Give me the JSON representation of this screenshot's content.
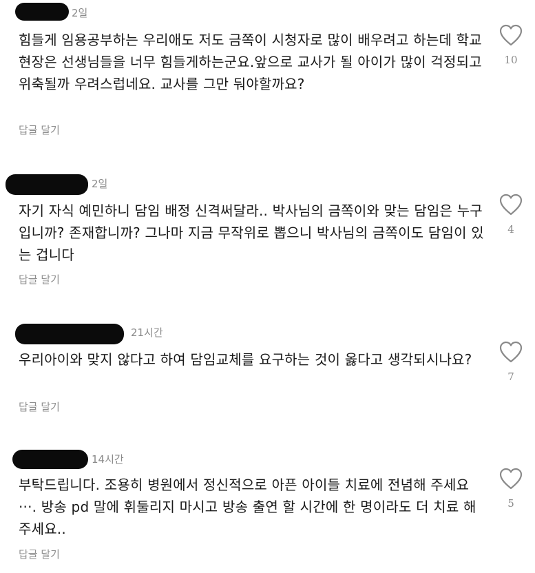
{
  "comments": [
    {
      "time": "2일",
      "text": "힘들게 임용공부하는 우리애도 저도 금쪽이 시청자로 많이 배우려고 하는데 학교현장은 선생님들을 너무 힘들게하는군요.앞으로 교사가 될 아이가 많이 걱정되고 위축될까 우려스럽네요. 교사를 그만 둬야할까요?",
      "reply_label": "답글 달기",
      "likes": "10"
    },
    {
      "time": "2일",
      "text": "자기 자식 예민하니 담임 배정 신격써달라.. 박사님의 금쪽이와 맞는 담임은 누구입니까? 존재합니까? 그나마 지금 무작위로 뽑으니 박사님의 금쪽이도 담임이 있는 겁니다",
      "reply_label": "답글 달기",
      "likes": "4"
    },
    {
      "time": "21시간",
      "text": "우리아이와 맞지 않다고 하여 담임교체를 요구하는 것이 옳다고 생각되시나요?",
      "reply_label": "답글 달기",
      "likes": "7"
    },
    {
      "time": "14시간",
      "text": "부탁드립니다. 조용히 병원에서 정신적으로 아픈 아이들 치료에 전념해 주세요···. 방송 pd 말에 휘둘리지 마시고 방송 출연 할 시간에 한 명이라도 더 치료 해 주세요..",
      "reply_label": "답글 달기",
      "likes": "5"
    }
  ],
  "icons": {
    "like": "heart-outline-icon"
  },
  "colors": {
    "text": "#1a1a1a",
    "meta": "#8a8a8a",
    "redaction": "#0b0b0b"
  }
}
